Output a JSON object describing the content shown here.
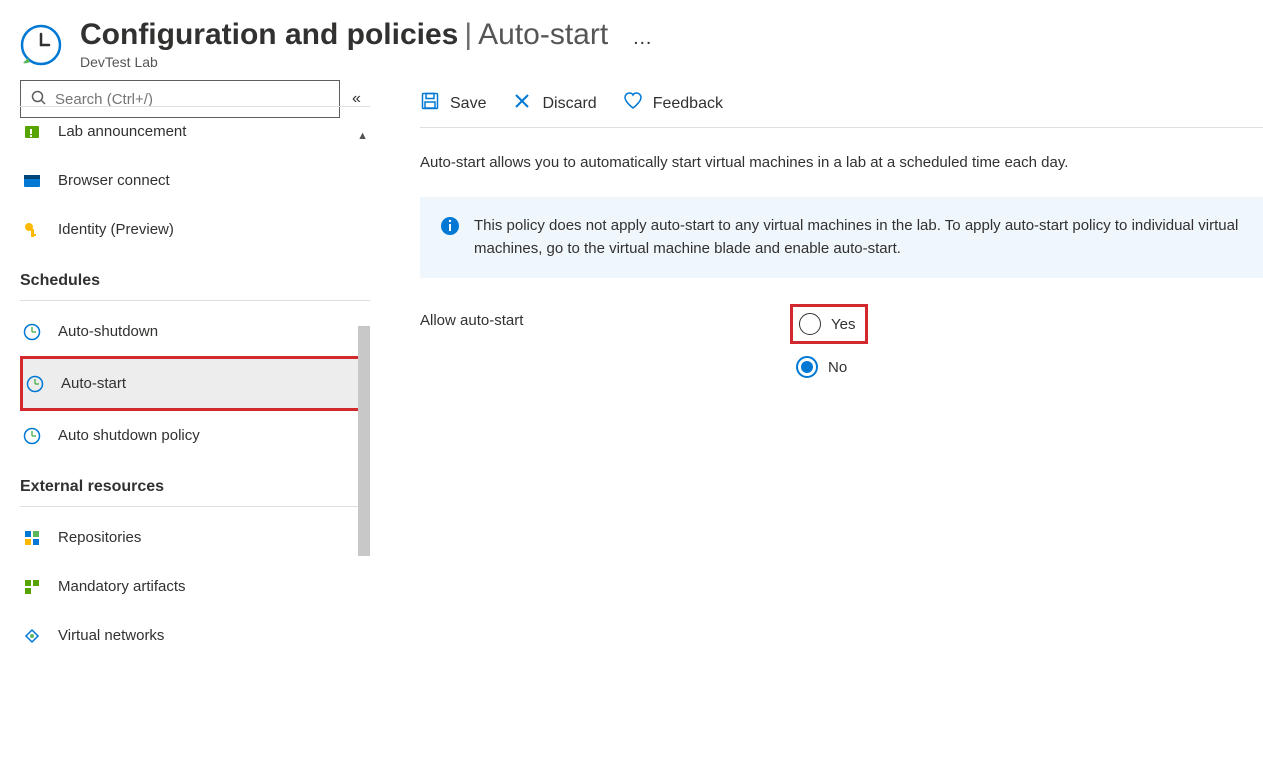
{
  "header": {
    "title": "Configuration and policies",
    "separator": "|",
    "subtitle_part": "Auto-start",
    "resource_type": "DevTest Lab"
  },
  "search": {
    "placeholder": "Search (Ctrl+/)"
  },
  "sidebar": {
    "items": [
      {
        "label": "Lab announcement",
        "icon": "announcement"
      },
      {
        "label": "Browser connect",
        "icon": "browser"
      },
      {
        "label": "Identity (Preview)",
        "icon": "key"
      }
    ],
    "section_schedules": "Schedules",
    "schedules": [
      {
        "label": "Auto-shutdown",
        "icon": "clock"
      },
      {
        "label": "Auto-start",
        "icon": "clock",
        "selected": true
      },
      {
        "label": "Auto shutdown policy",
        "icon": "clock"
      }
    ],
    "section_external": "External resources",
    "external": [
      {
        "label": "Repositories",
        "icon": "repo"
      },
      {
        "label": "Mandatory artifacts",
        "icon": "artifacts"
      },
      {
        "label": "Virtual networks",
        "icon": "vnet"
      }
    ]
  },
  "toolbar": {
    "save_label": "Save",
    "discard_label": "Discard",
    "feedback_label": "Feedback"
  },
  "main": {
    "description": "Auto-start allows you to automatically start virtual machines in a lab at a scheduled time each day.",
    "info_text": "This policy does not apply auto-start to any virtual machines in the lab. To apply auto-start policy to individual virtual machines, go to the virtual machine blade and enable auto-start.",
    "form_label": "Allow auto-start",
    "radio_yes": "Yes",
    "radio_no": "No"
  }
}
